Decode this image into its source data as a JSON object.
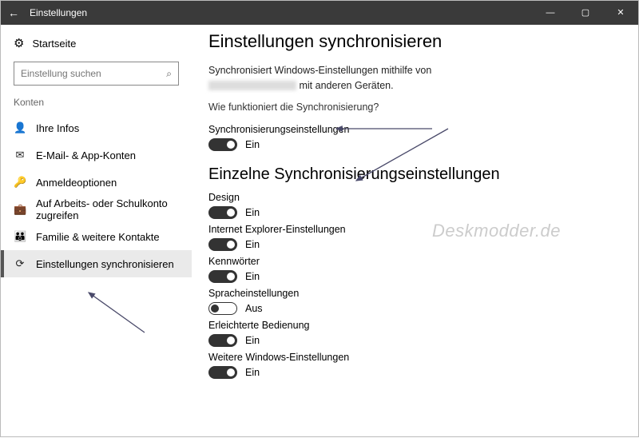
{
  "titlebar": {
    "title": "Einstellungen"
  },
  "sidebar": {
    "home": "Startseite",
    "search_placeholder": "Einstellung suchen",
    "group": "Konten",
    "items": [
      {
        "label": "Ihre Infos"
      },
      {
        "label": "E-Mail- & App-Konten"
      },
      {
        "label": "Anmeldeoptionen"
      },
      {
        "label": "Auf Arbeits- oder Schulkonto zugreifen"
      },
      {
        "label": "Familie & weitere Kontakte"
      },
      {
        "label": "Einstellungen synchronisieren"
      }
    ]
  },
  "main": {
    "title": "Einstellungen synchronisieren",
    "intro_pre": "Synchronisiert Windows-Einstellungen mithilfe von",
    "intro_post": "mit anderen Geräten.",
    "help_link": "Wie funktioniert die Synchronisierung?",
    "master": {
      "label": "Synchronisierungseinstellungen",
      "on": true,
      "state": "Ein"
    },
    "section": "Einzelne Synchronisierungseinstellungen",
    "settings": [
      {
        "label": "Design",
        "on": true,
        "state": "Ein"
      },
      {
        "label": "Internet Explorer-Einstellungen",
        "on": true,
        "state": "Ein"
      },
      {
        "label": "Kennwörter",
        "on": true,
        "state": "Ein"
      },
      {
        "label": "Spracheinstellungen",
        "on": false,
        "state": "Aus"
      },
      {
        "label": "Erleichterte Bedienung",
        "on": true,
        "state": "Ein"
      },
      {
        "label": "Weitere Windows-Einstellungen",
        "on": true,
        "state": "Ein"
      }
    ]
  },
  "watermark": "Deskmodder.de",
  "icons": {
    "nav": [
      "👤",
      "✉",
      "🔑",
      "💼",
      "👪",
      "⟳"
    ]
  }
}
